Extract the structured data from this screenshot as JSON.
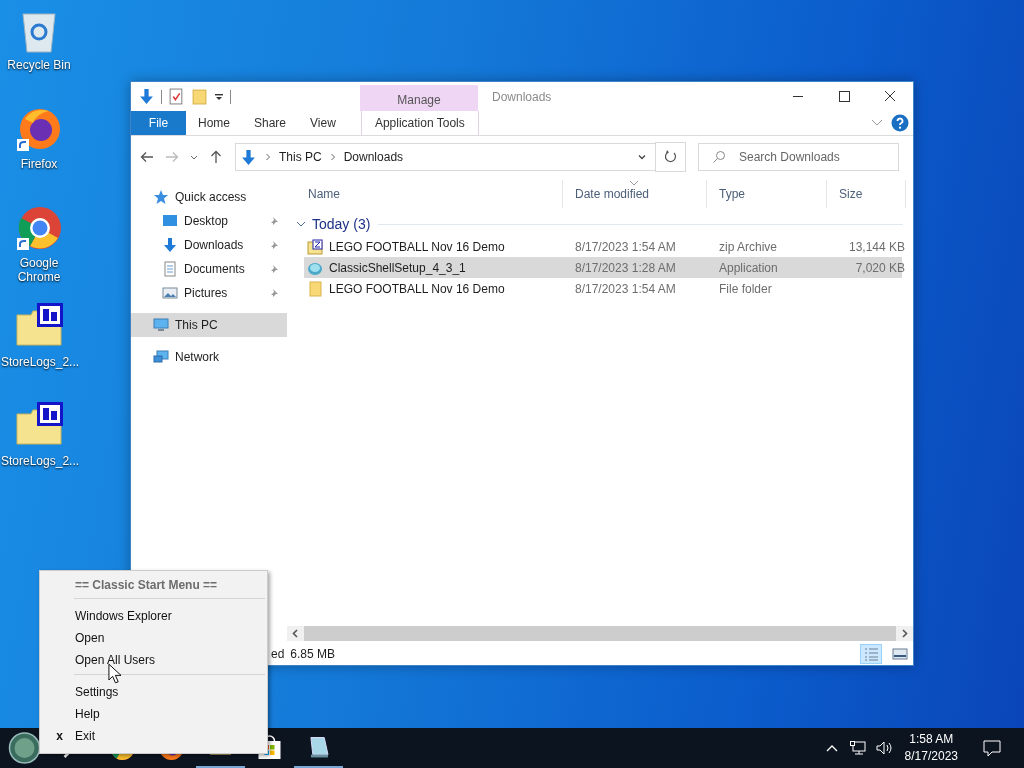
{
  "desktop_icons": [
    {
      "label": "Recycle Bin",
      "kind": "recycle",
      "shortcut": false
    },
    {
      "label": "Firefox",
      "kind": "firefox",
      "shortcut": true
    },
    {
      "label": "Google Chrome",
      "kind": "chrome",
      "shortcut": true
    },
    {
      "label": "StoreLogs_2...",
      "kind": "log",
      "shortcut": false
    },
    {
      "label": "StoreLogs_2...",
      "kind": "log",
      "shortcut": false
    }
  ],
  "window": {
    "context_header": "Manage",
    "title": "Downloads",
    "ribbon_tabs": [
      {
        "label": "File",
        "kind": "file"
      },
      {
        "label": "Home",
        "kind": "plain"
      },
      {
        "label": "Share",
        "kind": "plain"
      },
      {
        "label": "View",
        "kind": "plain"
      },
      {
        "label": "Application Tools",
        "kind": "contextual"
      }
    ],
    "address": [
      "This PC",
      "Downloads"
    ],
    "search": {
      "placeholder": "Search Downloads"
    },
    "navigation": [
      {
        "label": "Quick access",
        "kind": "star",
        "selected": false,
        "children": [
          {
            "label": "Desktop",
            "kind": "desktop",
            "pinned": true,
            "selected": false
          },
          {
            "label": "Downloads",
            "kind": "download",
            "pinned": true,
            "selected": false
          },
          {
            "label": "Documents",
            "kind": "document",
            "pinned": true,
            "selected": false
          },
          {
            "label": "Pictures",
            "kind": "pictures",
            "pinned": true,
            "selected": false
          }
        ]
      },
      {
        "label": "This PC",
        "kind": "pc",
        "selected": true
      },
      {
        "label": "Network",
        "kind": "network",
        "selected": false
      }
    ],
    "columns": [
      "Name",
      "Date modified",
      "Type",
      "Size"
    ],
    "group": {
      "label": "Today (3)",
      "expanded": true
    },
    "rows": [
      {
        "name": "LEGO FOOTBALL Nov 16 Demo",
        "date": "8/17/2023 1:54 AM",
        "type": "zip Archive",
        "size": "13,144 KB",
        "kind": "zip",
        "selected": false
      },
      {
        "name": "ClassicShellSetup_4_3_1",
        "date": "8/17/2023 1:28 AM",
        "type": "Application",
        "size": "7,020 KB",
        "kind": "app",
        "selected": true
      },
      {
        "name": "LEGO FOOTBALL Nov 16 Demo",
        "date": "8/17/2023 1:54 AM",
        "type": "File folder",
        "kind": "folder",
        "selected": false
      }
    ],
    "status_bar": [
      "ed",
      "6.85 MB"
    ],
    "views": [
      {
        "kind": "details",
        "selected": true
      },
      {
        "kind": "tiles",
        "selected": false
      }
    ]
  },
  "context_menu": {
    "title": "== Classic Start Menu ==",
    "sections": [
      [
        {
          "label": "Windows Explorer"
        },
        {
          "label": "Open"
        },
        {
          "label": "Open All Users"
        }
      ],
      [
        {
          "label": "Settings"
        },
        {
          "label": "Help"
        },
        {
          "label": "Exit",
          "mark": "x"
        }
      ]
    ]
  },
  "taskbar": {
    "apps": [
      {
        "kind": "start"
      },
      {
        "kind": "search"
      },
      {
        "kind": "chrome"
      },
      {
        "kind": "firefox"
      },
      {
        "kind": "explorer"
      },
      {
        "kind": "store"
      },
      {
        "kind": "notepad"
      }
    ],
    "time": "1:58 AM",
    "date": "8/17/2023"
  }
}
